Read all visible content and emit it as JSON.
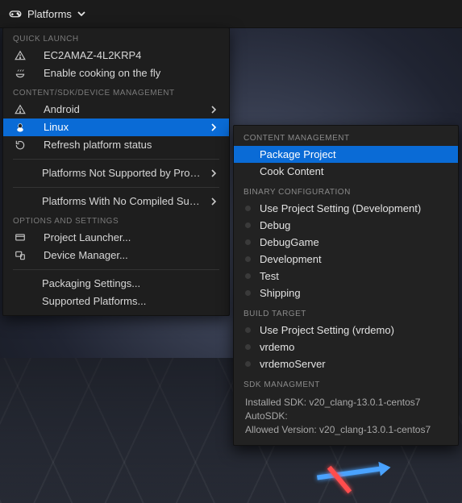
{
  "toolbar": {
    "title": "Platforms"
  },
  "menu": {
    "sections": {
      "quick_launch": {
        "header": "QUICK LAUNCH",
        "items": [
          {
            "label": "EC2AMAZ-4L2KRP4"
          },
          {
            "label": "Enable cooking on the fly"
          }
        ]
      },
      "content_mgmt": {
        "header": "CONTENT/SDK/DEVICE MANAGEMENT",
        "items": [
          {
            "label": "Android"
          },
          {
            "label": "Linux"
          },
          {
            "label": "Refresh platform status"
          },
          {
            "label": "Platforms Not Supported by Project"
          },
          {
            "label": "Platforms With No Compiled Support"
          }
        ]
      },
      "options": {
        "header": "OPTIONS AND SETTINGS",
        "items": [
          {
            "label": "Project Launcher..."
          },
          {
            "label": "Device Manager..."
          },
          {
            "label": "Packaging Settings..."
          },
          {
            "label": "Supported Platforms..."
          }
        ]
      }
    }
  },
  "submenu": {
    "content_management": {
      "header": "CONTENT MANAGEMENT",
      "items": [
        {
          "label": "Package Project"
        },
        {
          "label": "Cook Content"
        }
      ]
    },
    "binary_configuration": {
      "header": "BINARY CONFIGURATION",
      "items": [
        {
          "label": "Use Project Setting (Development)"
        },
        {
          "label": "Debug"
        },
        {
          "label": "DebugGame"
        },
        {
          "label": "Development"
        },
        {
          "label": "Test"
        },
        {
          "label": "Shipping"
        }
      ]
    },
    "build_target": {
      "header": "BUILD TARGET",
      "items": [
        {
          "label": "Use Project Setting (vrdemo)"
        },
        {
          "label": "vrdemo"
        },
        {
          "label": "vrdemoServer"
        }
      ]
    },
    "sdk": {
      "header": "SDK MANAGMENT",
      "installed": "Installed SDK: v20_clang-13.0.1-centos7",
      "autosdk": "AutoSDK:",
      "allowed": "Allowed Version: v20_clang-13.0.1-centos7"
    }
  }
}
